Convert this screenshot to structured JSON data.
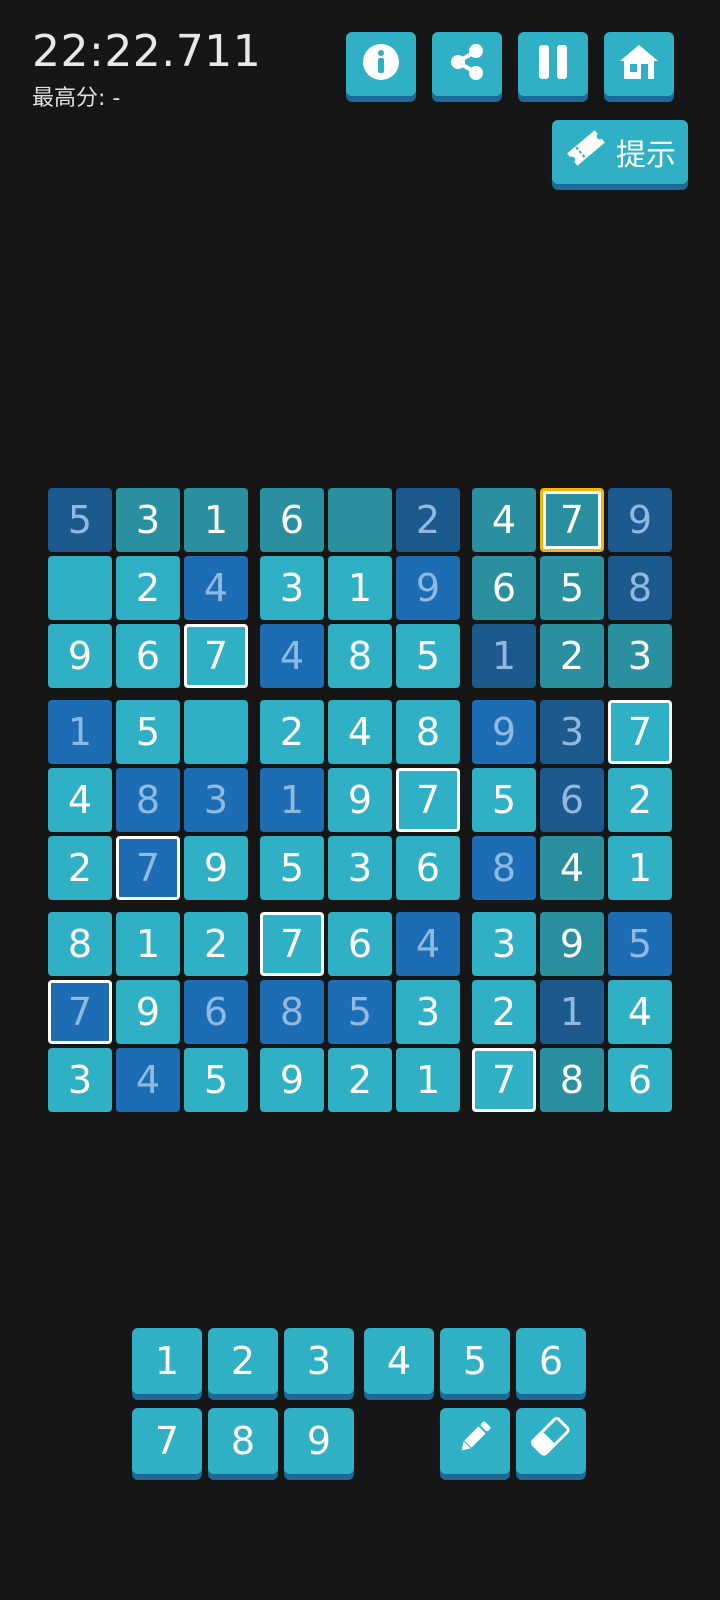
{
  "header": {
    "timer": "22:22.711",
    "best_score_label": "最高分: -"
  },
  "toolbar": {
    "info_icon": "info-icon",
    "share_icon": "share-icon",
    "pause_icon": "pause-icon",
    "home_icon": "home-icon",
    "hint_label": "提示",
    "hint_icon": "ticket-icon"
  },
  "colors": {
    "light": "#2fb0c4",
    "teal": "#2a8f9e",
    "blue": "#1d6db4",
    "navy": "#1c5a8e",
    "background": "#161616",
    "selected_border": "#ffffff",
    "active_border": "#f2b705"
  },
  "board": {
    "rows": [
      [
        "5",
        "3",
        "1",
        "6",
        "",
        "2",
        "4",
        "7",
        "9"
      ],
      [
        "",
        "2",
        "4",
        "3",
        "1",
        "9",
        "6",
        "5",
        "8"
      ],
      [
        "9",
        "6",
        "7",
        "4",
        "8",
        "5",
        "1",
        "2",
        "3"
      ],
      [
        "1",
        "5",
        "",
        "2",
        "4",
        "8",
        "9",
        "3",
        "7"
      ],
      [
        "4",
        "8",
        "3",
        "1",
        "9",
        "7",
        "5",
        "6",
        "2"
      ],
      [
        "2",
        "7",
        "9",
        "5",
        "3",
        "6",
        "8",
        "4",
        "1"
      ],
      [
        "8",
        "1",
        "2",
        "7",
        "6",
        "4",
        "3",
        "9",
        "5"
      ],
      [
        "7",
        "9",
        "6",
        "8",
        "5",
        "3",
        "2",
        "1",
        "4"
      ],
      [
        "3",
        "4",
        "5",
        "9",
        "2",
        "1",
        "7",
        "8",
        "6"
      ]
    ],
    "tones": [
      [
        "navy",
        "teal",
        "teal",
        "teal",
        "teal",
        "navy",
        "teal",
        "teal",
        "navy"
      ],
      [
        "light",
        "light",
        "blue",
        "light",
        "light",
        "blue",
        "teal",
        "teal",
        "navy"
      ],
      [
        "light",
        "light",
        "light",
        "blue",
        "light",
        "light",
        "navy",
        "teal",
        "teal"
      ],
      [
        "blue",
        "light",
        "light",
        "light",
        "light",
        "light",
        "blue",
        "navy",
        "light"
      ],
      [
        "light",
        "blue",
        "blue",
        "blue",
        "light",
        "light",
        "light",
        "navy",
        "light"
      ],
      [
        "light",
        "blue",
        "light",
        "light",
        "light",
        "light",
        "blue",
        "teal",
        "light"
      ],
      [
        "light",
        "light",
        "light",
        "light",
        "light",
        "blue",
        "light",
        "teal",
        "blue"
      ],
      [
        "blue",
        "light",
        "blue",
        "blue",
        "blue",
        "light",
        "light",
        "navy",
        "light"
      ],
      [
        "light",
        "blue",
        "light",
        "light",
        "light",
        "light",
        "light",
        "teal",
        "light"
      ]
    ],
    "highlighted_cells": [
      [
        0,
        7
      ],
      [
        2,
        2
      ],
      [
        3,
        8
      ],
      [
        4,
        5
      ],
      [
        5,
        1
      ],
      [
        6,
        3
      ],
      [
        7,
        0
      ],
      [
        8,
        6
      ]
    ],
    "active_cell": [
      0,
      7
    ]
  },
  "numpad": {
    "keys": [
      "1",
      "2",
      "3",
      "4",
      "5",
      "6",
      "7",
      "8",
      "9"
    ],
    "pencil_icon": "pencil-icon",
    "eraser_icon": "eraser-icon"
  }
}
